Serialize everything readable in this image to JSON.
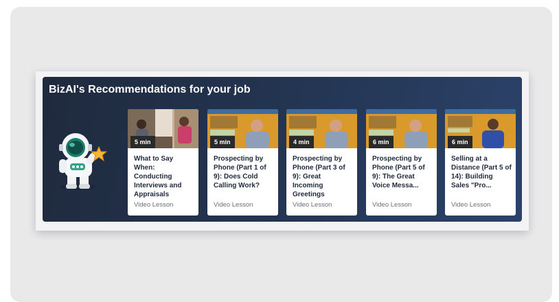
{
  "panel": {
    "title": "BizAI's Recommendations for your job"
  },
  "mascot": {
    "icon": "astronaut-with-star-icon"
  },
  "cards": [
    {
      "duration": "5 min",
      "title": "What to Say When: Conducting Interviews and Appraisals",
      "type": "Video Lesson",
      "thumbnail": "interview-scene"
    },
    {
      "duration": "5 min",
      "title": "Prospecting by Phone (Part 1 of 9): Does Cold Calling Work?",
      "type": "Video Lesson",
      "thumbnail": "presenter-bald-man"
    },
    {
      "duration": "4 min",
      "title": "Prospecting by Phone (Part 3 of 9): Great Incoming Greetings",
      "type": "Video Lesson",
      "thumbnail": "presenter-bald-man"
    },
    {
      "duration": "6 min",
      "title": "Prospecting by Phone (Part 5 of 9): The Great Voice Messa...",
      "type": "Video Lesson",
      "thumbnail": "presenter-bald-man"
    },
    {
      "duration": "6 min",
      "title": "Selling at a Distance (Part 5 of 14): Building Sales \"Pro...",
      "type": "Video Lesson",
      "thumbnail": "presenter-woman"
    }
  ],
  "colors": {
    "panel_bg": "#243654",
    "card_title": "#1f2a3d",
    "card_type": "#6b6f76",
    "badge_bg": "#2a2a2a"
  }
}
